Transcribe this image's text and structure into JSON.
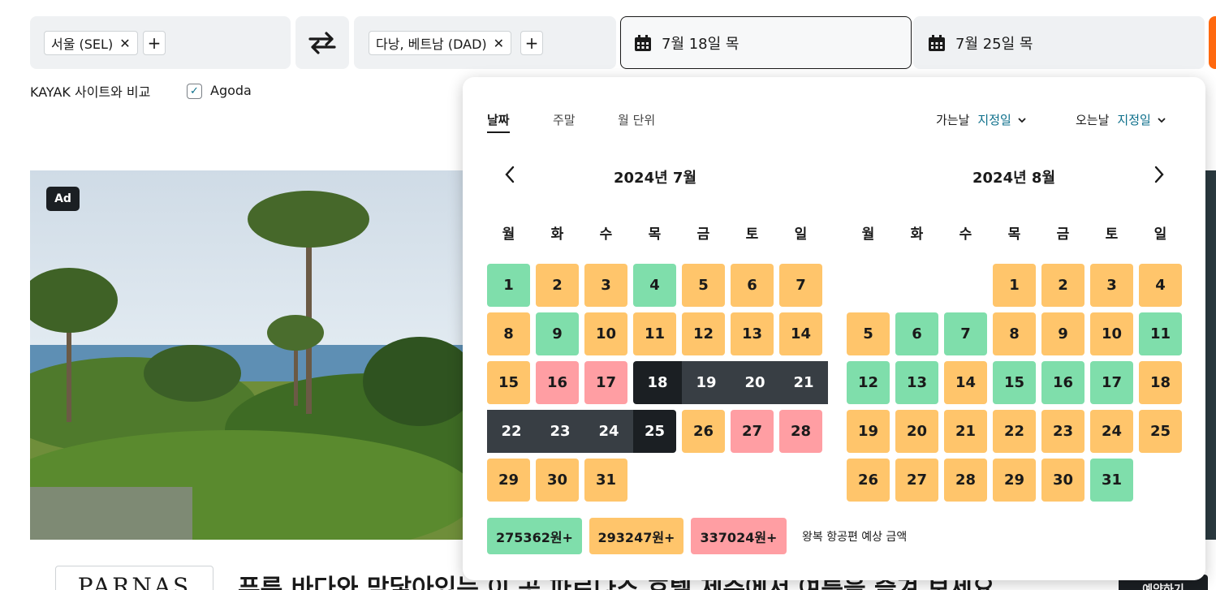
{
  "search": {
    "origin_chip": "서울 (SEL)",
    "destination_chip": "다낭, 베트남 (DAD)",
    "chip_close": "✕",
    "add": "+",
    "swap_glyph": "⇄",
    "depart_date": "7월 18일 목",
    "return_date": "7월 25일 목"
  },
  "compare": {
    "label": "KAYAK 사이트와 비교",
    "option": "Agoda",
    "checked": true,
    "check_glyph": "✓"
  },
  "ad": {
    "badge": "Ad",
    "brand": "PARNAS",
    "headline": "푸른 바다와 맞닿아있는 이 곳 파르나스 호텔 제주에서 여름을 즐겨 보세요.",
    "cta": "예약하기"
  },
  "datepicker": {
    "tabs": [
      "날짜",
      "주말",
      "월 단위"
    ],
    "active_tab": "날짜",
    "depart_flex_label": "가는날",
    "depart_flex_value": "지정일",
    "return_flex_label": "오는날",
    "return_flex_value": "지정일",
    "prev_glyph": "‹",
    "next_glyph": "›",
    "weekdays": [
      "월",
      "화",
      "수",
      "목",
      "금",
      "토",
      "일"
    ],
    "months": [
      {
        "title": "2024년 7월",
        "first_weekday_index": 0,
        "days": [
          {
            "d": "1",
            "p": "low"
          },
          {
            "d": "2",
            "p": "mid"
          },
          {
            "d": "3",
            "p": "mid"
          },
          {
            "d": "4",
            "p": "low"
          },
          {
            "d": "5",
            "p": "mid"
          },
          {
            "d": "6",
            "p": "mid"
          },
          {
            "d": "7",
            "p": "mid"
          },
          {
            "d": "8",
            "p": "mid"
          },
          {
            "d": "9",
            "p": "low"
          },
          {
            "d": "10",
            "p": "mid"
          },
          {
            "d": "11",
            "p": "mid"
          },
          {
            "d": "12",
            "p": "mid"
          },
          {
            "d": "13",
            "p": "mid"
          },
          {
            "d": "14",
            "p": "mid"
          },
          {
            "d": "15",
            "p": "mid"
          },
          {
            "d": "16",
            "p": "high"
          },
          {
            "d": "17",
            "p": "high"
          },
          {
            "d": "18",
            "p": "sel-start"
          },
          {
            "d": "19",
            "p": "sel"
          },
          {
            "d": "20",
            "p": "sel"
          },
          {
            "d": "21",
            "p": "sel"
          },
          {
            "d": "22",
            "p": "sel"
          },
          {
            "d": "23",
            "p": "sel"
          },
          {
            "d": "24",
            "p": "sel"
          },
          {
            "d": "25",
            "p": "sel-end"
          },
          {
            "d": "26",
            "p": "mid"
          },
          {
            "d": "27",
            "p": "high"
          },
          {
            "d": "28",
            "p": "high"
          },
          {
            "d": "29",
            "p": "mid"
          },
          {
            "d": "30",
            "p": "mid"
          },
          {
            "d": "31",
            "p": "mid"
          }
        ]
      },
      {
        "title": "2024년 8월",
        "first_weekday_index": 3,
        "days": [
          {
            "d": "1",
            "p": "mid"
          },
          {
            "d": "2",
            "p": "mid"
          },
          {
            "d": "3",
            "p": "mid"
          },
          {
            "d": "4",
            "p": "mid"
          },
          {
            "d": "5",
            "p": "mid"
          },
          {
            "d": "6",
            "p": "low"
          },
          {
            "d": "7",
            "p": "low"
          },
          {
            "d": "8",
            "p": "mid"
          },
          {
            "d": "9",
            "p": "mid"
          },
          {
            "d": "10",
            "p": "mid"
          },
          {
            "d": "11",
            "p": "low"
          },
          {
            "d": "12",
            "p": "low"
          },
          {
            "d": "13",
            "p": "low"
          },
          {
            "d": "14",
            "p": "mid"
          },
          {
            "d": "15",
            "p": "low"
          },
          {
            "d": "16",
            "p": "low"
          },
          {
            "d": "17",
            "p": "low"
          },
          {
            "d": "18",
            "p": "mid"
          },
          {
            "d": "19",
            "p": "mid"
          },
          {
            "d": "20",
            "p": "mid"
          },
          {
            "d": "21",
            "p": "mid"
          },
          {
            "d": "22",
            "p": "mid"
          },
          {
            "d": "23",
            "p": "mid"
          },
          {
            "d": "24",
            "p": "mid"
          },
          {
            "d": "25",
            "p": "mid"
          },
          {
            "d": "26",
            "p": "mid"
          },
          {
            "d": "27",
            "p": "mid"
          },
          {
            "d": "28",
            "p": "mid"
          },
          {
            "d": "29",
            "p": "mid"
          },
          {
            "d": "30",
            "p": "mid"
          },
          {
            "d": "31",
            "p": "low"
          }
        ]
      }
    ],
    "legend": {
      "low": "275362원+",
      "mid": "293247원+",
      "high": "337024원+",
      "note": "왕복 항공편 예상 금액"
    },
    "colors": {
      "low": "#7fdeab",
      "mid": "#ffc56b",
      "high": "#ff9ea3",
      "selected": "#383e44",
      "accent": "#0b6e8a"
    }
  }
}
